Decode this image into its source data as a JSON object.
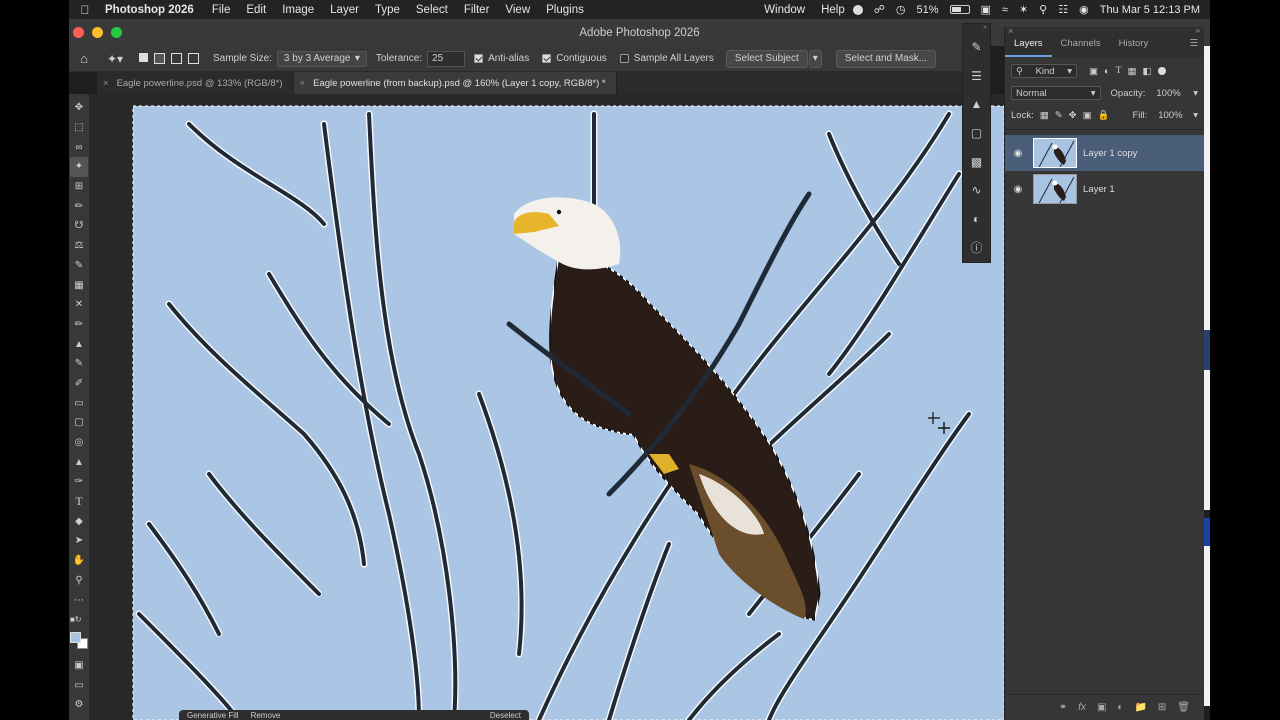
{
  "menubar": {
    "app_name": "Photoshop 2026",
    "items": [
      "File",
      "Edit",
      "Image",
      "Layer",
      "Type",
      "Select",
      "Filter",
      "View",
      "Plugins"
    ],
    "right_items": [
      "Window",
      "Help"
    ],
    "battery": "51%",
    "datetime": "Thu Mar 5  12:13 PM"
  },
  "window": {
    "title": "Adobe Photoshop 2026"
  },
  "options": {
    "sample_size_label": "Sample Size:",
    "sample_size_value": "3 by 3 Average",
    "tolerance_label": "Tolerance:",
    "tolerance_value": "25",
    "anti_alias_label": "Anti-alias",
    "contiguous_label": "Contiguous",
    "sample_all_layers_label": "Sample All Layers",
    "select_subject_label": "Select Subject",
    "select_and_mask_label": "Select and Mask..."
  },
  "doc_tabs": [
    {
      "label": "Eagle powerline.psd @ 133% (RGB/8*)"
    },
    {
      "label": "Eagle powerline (from backup).psd @ 160% (Layer 1 copy, RGB/8*) *"
    }
  ],
  "layers_panel": {
    "tabs": [
      "Layers",
      "Channels",
      "History"
    ],
    "filter_kind": "Kind",
    "blend_mode": "Normal",
    "opacity_label": "Opacity:",
    "opacity_value": "100%",
    "lock_label": "Lock:",
    "fill_label": "Fill:",
    "fill_value": "100%",
    "layers": [
      {
        "name": "Layer 1 copy",
        "selected": true
      },
      {
        "name": "Layer 1",
        "selected": false
      }
    ]
  },
  "bottom_bar": {
    "generative_fill": "Generative Fill",
    "remove": "Remove",
    "deselect": "Deselect"
  },
  "colors": {
    "sky": "#abc6e4",
    "accent_blue": "#4a5e7a",
    "panel_bg": "#363636"
  }
}
